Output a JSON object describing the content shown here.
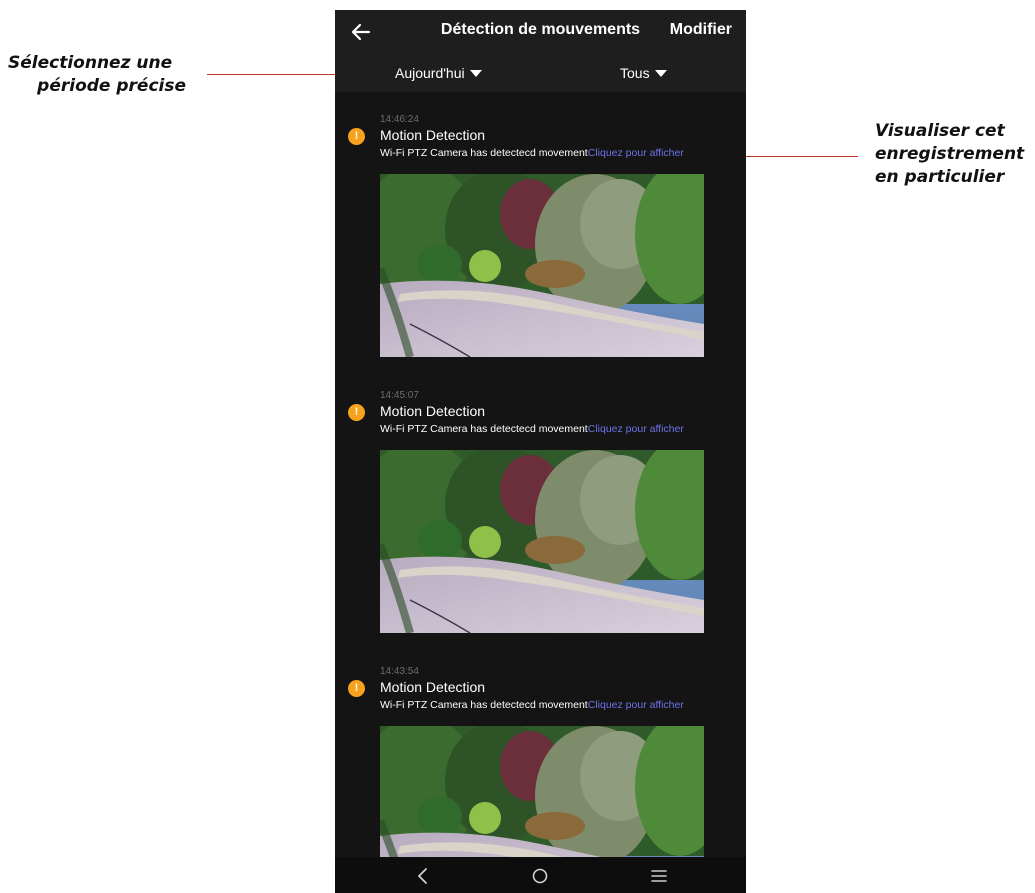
{
  "annotations": {
    "left_line1": "Sélectionnez une",
    "left_line2": "période précise",
    "right_line1": "Visualiser cet",
    "right_line2": "enregistrement",
    "right_line3": "en particulier",
    "line_color": "#c0392b"
  },
  "app": {
    "title": "Détection de mouvements",
    "back_icon": "arrow-left-icon",
    "edit_label": "Modifier"
  },
  "filters": {
    "period": "Aujourd'hui",
    "type": "Tous"
  },
  "events": [
    {
      "time": "14:46:24",
      "title": "Motion Detection",
      "description": "Wi-Fi PTZ Camera  has detectecd movement",
      "link": "Cliquez pour afficher"
    },
    {
      "time": "14:45:07",
      "title": "Motion Detection",
      "description": "Wi-Fi PTZ Camera  has detectecd movement",
      "link": "Cliquez pour afficher"
    },
    {
      "time": "14:43:54",
      "title": "Motion Detection",
      "description": "Wi-Fi PTZ Camera  has detectecd movement",
      "link": "Cliquez pour afficher"
    }
  ],
  "colors": {
    "background": "#141414",
    "appbar": "#1e1e1e",
    "alert": "#f7a21c",
    "link": "#6b74e8",
    "timestamp": "#6e6e6e"
  },
  "navbar": {
    "icons": [
      "back-nav-icon",
      "home-nav-icon",
      "menu-nav-icon"
    ]
  }
}
